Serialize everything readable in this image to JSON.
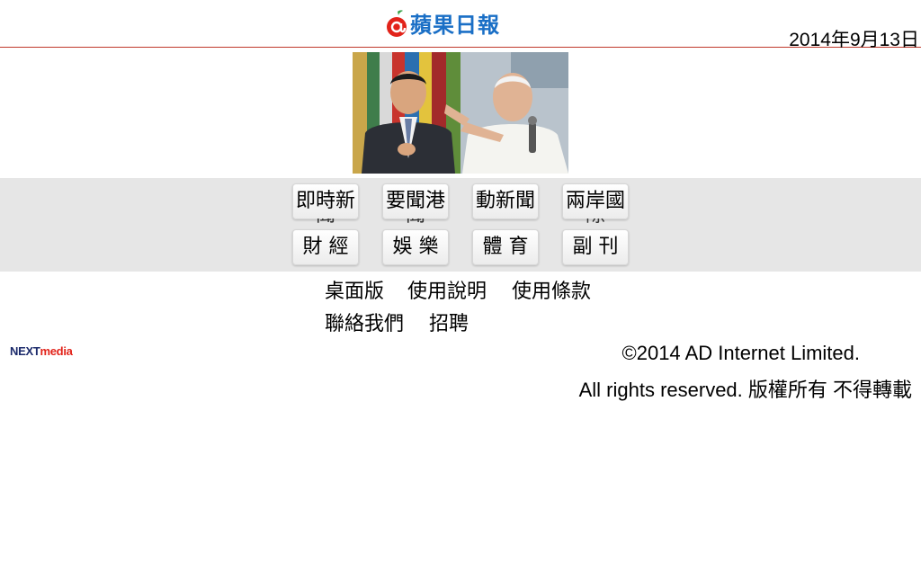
{
  "header": {
    "logo_text": "蘋果日報",
    "date": "2014年9月13日",
    "hero_image_alt": "headline photo"
  },
  "nav": {
    "row1": [
      {
        "label": "即時新",
        "overflow": "聞"
      },
      {
        "label": "要聞港",
        "overflow": "聞"
      },
      {
        "label": "動新聞",
        "overflow": ""
      },
      {
        "label": "兩岸國",
        "overflow": "際"
      }
    ],
    "row2": [
      {
        "label": "財 經"
      },
      {
        "label": "娛 樂"
      },
      {
        "label": "體 育"
      },
      {
        "label": "副 刊"
      }
    ]
  },
  "footer_links": {
    "desktop": "桌面版",
    "manual": "使用說明",
    "terms": "使用條款",
    "contact": "聯絡我們",
    "jobs": "招聘"
  },
  "footer": {
    "brand_next": "NEXT",
    "brand_media": "media",
    "copyright": "©2014 AD Internet Limited.",
    "rights": "All rights reserved. 版權所有 不得轉載"
  },
  "colors": {
    "logo_blue": "#1a6fc6",
    "logo_red": "#e2231a",
    "divider_red": "#c0392b",
    "nav_band": "#e6e6e6",
    "next_navy": "#1b2a6b"
  }
}
